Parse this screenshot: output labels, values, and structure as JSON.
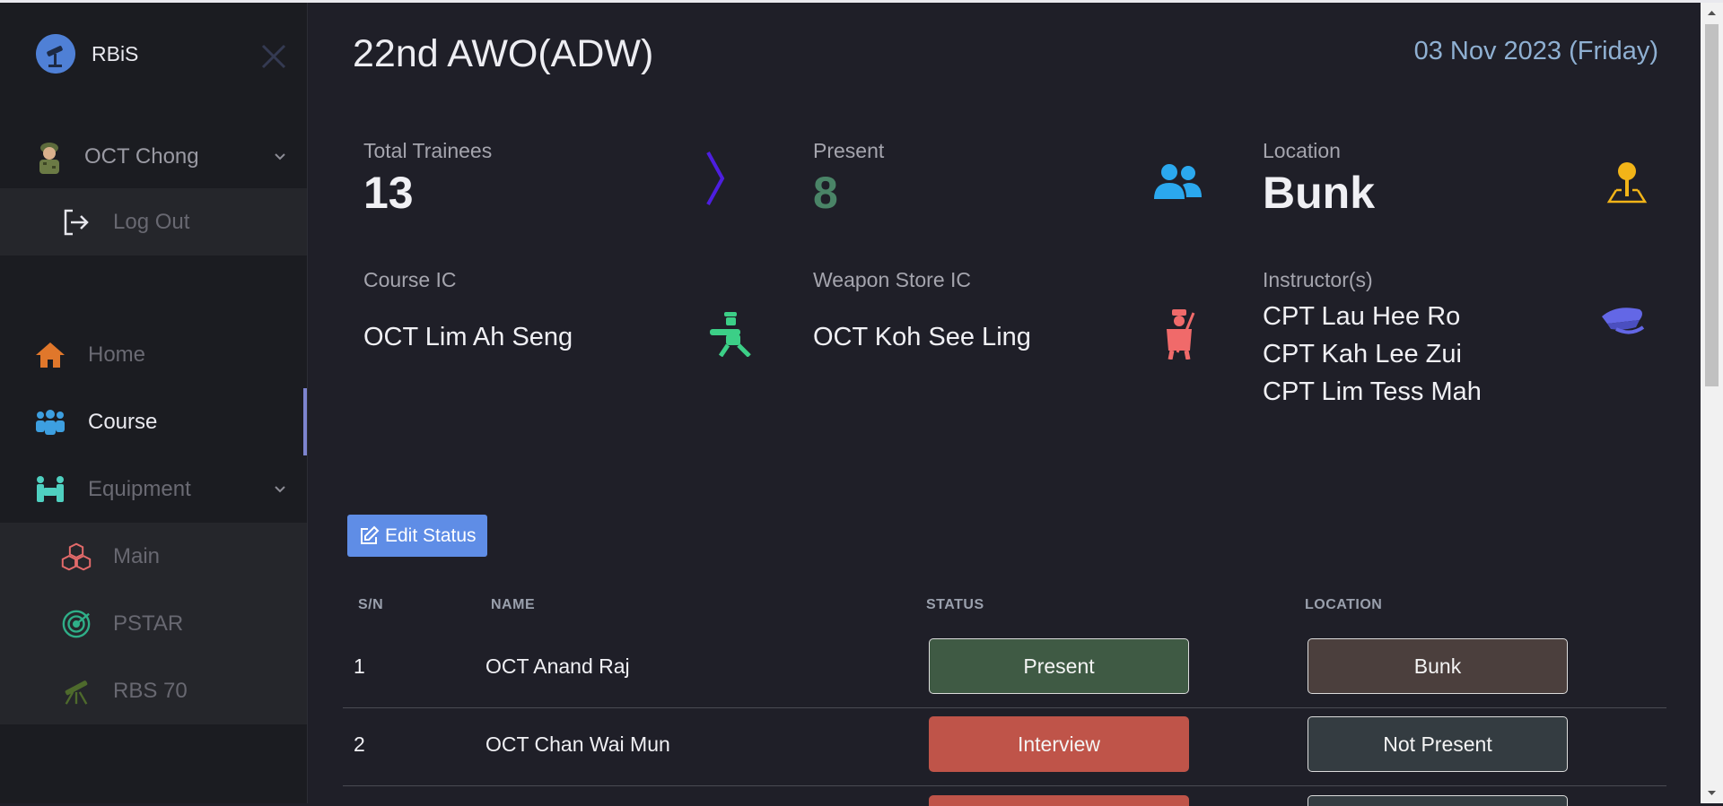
{
  "sidebar": {
    "brand": "RBiS",
    "user": {
      "name": "OCT Chong",
      "logout": "Log Out"
    },
    "nav": [
      {
        "label": "Home",
        "icon": "home-icon"
      },
      {
        "label": "Course",
        "icon": "people-group-icon",
        "active": true
      },
      {
        "label": "Equipment",
        "icon": "equipment-icon"
      }
    ],
    "equipment_sub": [
      {
        "label": "Main",
        "icon": "cubes-icon"
      },
      {
        "label": "PSTAR",
        "icon": "radar-icon"
      },
      {
        "label": "RBS 70",
        "icon": "missile-launcher-icon"
      }
    ]
  },
  "header": {
    "title": "22nd AWO(ADW)",
    "date": "03 Nov 2023 (Friday)"
  },
  "cards": {
    "total_trainees": {
      "label": "Total Trainees",
      "value": "13"
    },
    "present": {
      "label": "Present",
      "value": "8"
    },
    "location": {
      "label": "Location",
      "value": "Bunk"
    },
    "course_ic": {
      "label": "Course IC",
      "value": "OCT Lim Ah Seng"
    },
    "weapon_store_ic": {
      "label": "Weapon Store IC",
      "value": "OCT Koh See Ling"
    },
    "instructors": {
      "label": "Instructor(s)",
      "values": [
        "CPT Lau Hee Ro",
        "CPT Kah Lee Zui",
        "CPT Lim Tess Mah"
      ]
    }
  },
  "edit_status_label": "Edit Status",
  "table": {
    "headers": {
      "sn": "S/N",
      "name": "NAME",
      "status": "STATUS",
      "location": "LOCATION"
    },
    "rows": [
      {
        "sn": "1",
        "name": "OCT Anand Raj",
        "status": "Present",
        "location": "Bunk"
      },
      {
        "sn": "2",
        "name": "OCT Chan Wai Mun",
        "status": "Interview",
        "location": "Not Present"
      }
    ]
  },
  "colors": {
    "status_present": "#3f5a44",
    "status_interview": "#bf5449",
    "location_bunk": "#4b3f3d",
    "location_not_present": "#343c41",
    "present_value": "#4a8467",
    "accent_purple": "#4d1ee0",
    "accent_blue": "#2ba8ee",
    "accent_yellow": "#f2b418",
    "accent_green": "#3ccf87",
    "accent_red": "#f06a6a",
    "accent_violet": "#6367e6"
  }
}
